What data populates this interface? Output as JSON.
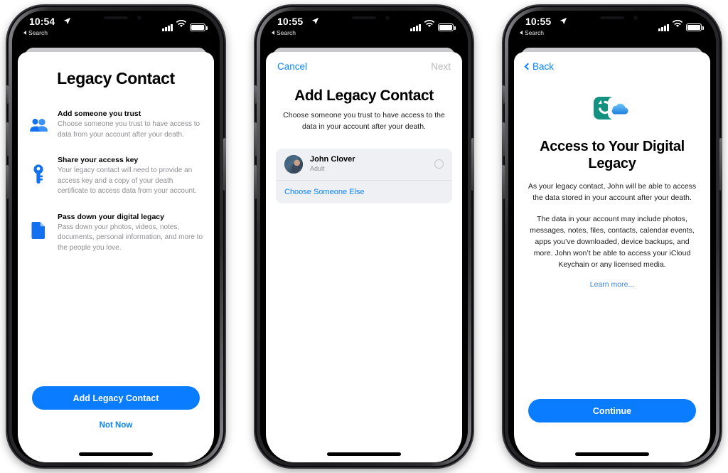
{
  "phones": [
    {
      "id": "legacy-contact-intro",
      "status_bar": {
        "time": "10:54",
        "back_label": "Search",
        "location_icon": "location-arrow-icon",
        "signal_icon": "cellular-signal-icon",
        "wifi_icon": "wifi-icon",
        "battery_icon": "battery-icon"
      },
      "title": "Legacy Contact",
      "features": [
        {
          "icon": "two-people-icon",
          "title": "Add someone you trust",
          "desc": "Choose someone you trust to have access to data from your account after your death."
        },
        {
          "icon": "key-icon",
          "title": "Share your access key",
          "desc": "Your legacy contact will need to provide an access key and a copy of your death certificate to access data from your account."
        },
        {
          "icon": "document-icon",
          "title": "Pass down your digital legacy",
          "desc": "Pass down your photos, videos, notes, documents, personal information, and more to the people you love."
        }
      ],
      "primary_button": "Add Legacy Contact",
      "secondary_button": "Not Now"
    },
    {
      "id": "add-legacy-contact",
      "status_bar": {
        "time": "10:55",
        "back_label": "Search",
        "location_icon": "location-arrow-icon",
        "signal_icon": "cellular-signal-icon",
        "wifi_icon": "wifi-icon",
        "battery_icon": "battery-icon"
      },
      "nav": {
        "cancel": "Cancel",
        "next": "Next",
        "next_enabled": false
      },
      "title": "Add Legacy Contact",
      "subtitle": "Choose someone you trust to have access to the data in your account after your death.",
      "contact": {
        "name": "John Clover",
        "subtitle": "Adult",
        "avatar": "contact-photo",
        "selected": false
      },
      "choose_other": "Choose Someone Else"
    },
    {
      "id": "access-digital-legacy",
      "status_bar": {
        "time": "10:55",
        "back_label": "Search",
        "location_icon": "location-arrow-icon",
        "signal_icon": "cellular-signal-icon",
        "wifi_icon": "wifi-icon",
        "battery_icon": "battery-icon"
      },
      "nav": {
        "back": "Back"
      },
      "app_icon": "icloud-data-recovery-icon",
      "title": "Access to Your Digital Legacy",
      "paragraph1": "As your legacy contact, John will be able to access the data stored in your account after your death.",
      "paragraph2": "The data in your account may include photos, messages, notes, files, contacts, calendar events, apps you’ve downloaded, device backups, and more. John won’t be able to access your iCloud Keychain or any licensed media.",
      "learn_more": "Learn more...",
      "primary_button": "Continue"
    }
  ],
  "colors": {
    "ios_blue": "#0a7cff",
    "link_blue": "#0a84ff",
    "muted_gray": "#8e8e93",
    "disabled_gray": "#b9b9be",
    "card_bg": "#eef0f3",
    "icloud_teal": "#1d9e8a"
  }
}
